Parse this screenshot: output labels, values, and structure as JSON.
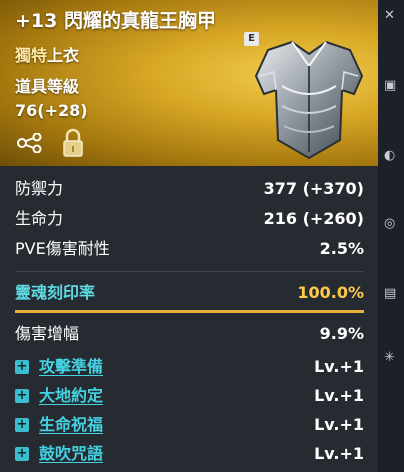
{
  "item": {
    "title": "+13 閃耀的真龍王胸甲",
    "grade_badge": "E",
    "type_prefix": "獨特",
    "type": "上衣",
    "level_label": "道具等級",
    "level_value": "76(+28)"
  },
  "stats": [
    {
      "label": "防禦力",
      "value": "377 (+370)"
    },
    {
      "label": "生命力",
      "value": "216 (+260)"
    },
    {
      "label": "PVE傷害耐性",
      "value": "2.5%"
    }
  ],
  "soul": {
    "label": "靈魂刻印率",
    "value": "100.0%",
    "progress": 1.0
  },
  "extra": {
    "label": "傷害增幅",
    "value": "9.9%"
  },
  "skills": [
    {
      "label": "攻擊準備",
      "value": "Lv.+1"
    },
    {
      "label": "大地約定",
      "value": "Lv.+1"
    },
    {
      "label": "生命祝福",
      "value": "Lv.+1"
    },
    {
      "label": "鼓吹咒語",
      "value": "Lv.+1"
    }
  ],
  "icons": {
    "share": "share-icon",
    "lock": "lock-icon",
    "armor": "chest-armor-icon",
    "skill_marker": "plus-box-icon",
    "side_icons": [
      "sidebar-icon-1",
      "sidebar-icon-2",
      "sidebar-icon-3",
      "sidebar-icon-4",
      "sidebar-icon-5",
      "sidebar-icon-6"
    ]
  },
  "colors": {
    "soul_label": "#5fd9e2",
    "soul_value": "#ffc94a",
    "skill_link": "#44d2e2",
    "header_gold": "#d7a625"
  }
}
